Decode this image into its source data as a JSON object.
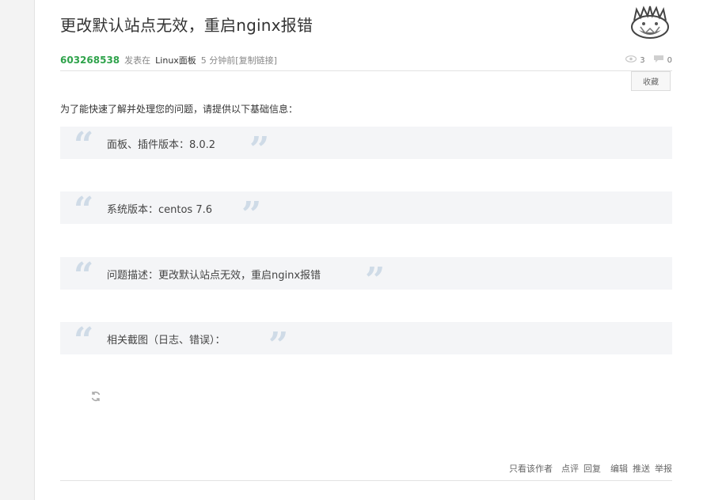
{
  "post": {
    "title": "更改默认站点无效，重启nginx报错",
    "author": "603268538",
    "posted_in": "发表在",
    "board": "Linux面板",
    "time": "5 分钟前",
    "copy_link": "[复制链接]",
    "views": "3",
    "replies": "0",
    "favorite_label": "收藏",
    "intro": "为了能快速了解并处理您的问题，请提供以下基础信息：",
    "quotes": [
      "面板、插件版本：8.0.2",
      "系统版本：centos 7.6",
      "问题描述：更改默认站点无效，重启nginx报错",
      "相关截图（日志、错误）："
    ]
  },
  "actions": {
    "author_only": "只看该作者",
    "comment": "点评",
    "reply": "回复",
    "edit": "编辑",
    "push": "推送",
    "report": "举报"
  },
  "icons": {
    "views": "eye-icon",
    "replies": "comment-icon",
    "loading": "refresh-icon",
    "avatar": "avatar-logo"
  },
  "colors": {
    "author": "#2fa34b",
    "quote_bg": "#f4f5f7",
    "quote_mark": "#cfdbe7"
  }
}
